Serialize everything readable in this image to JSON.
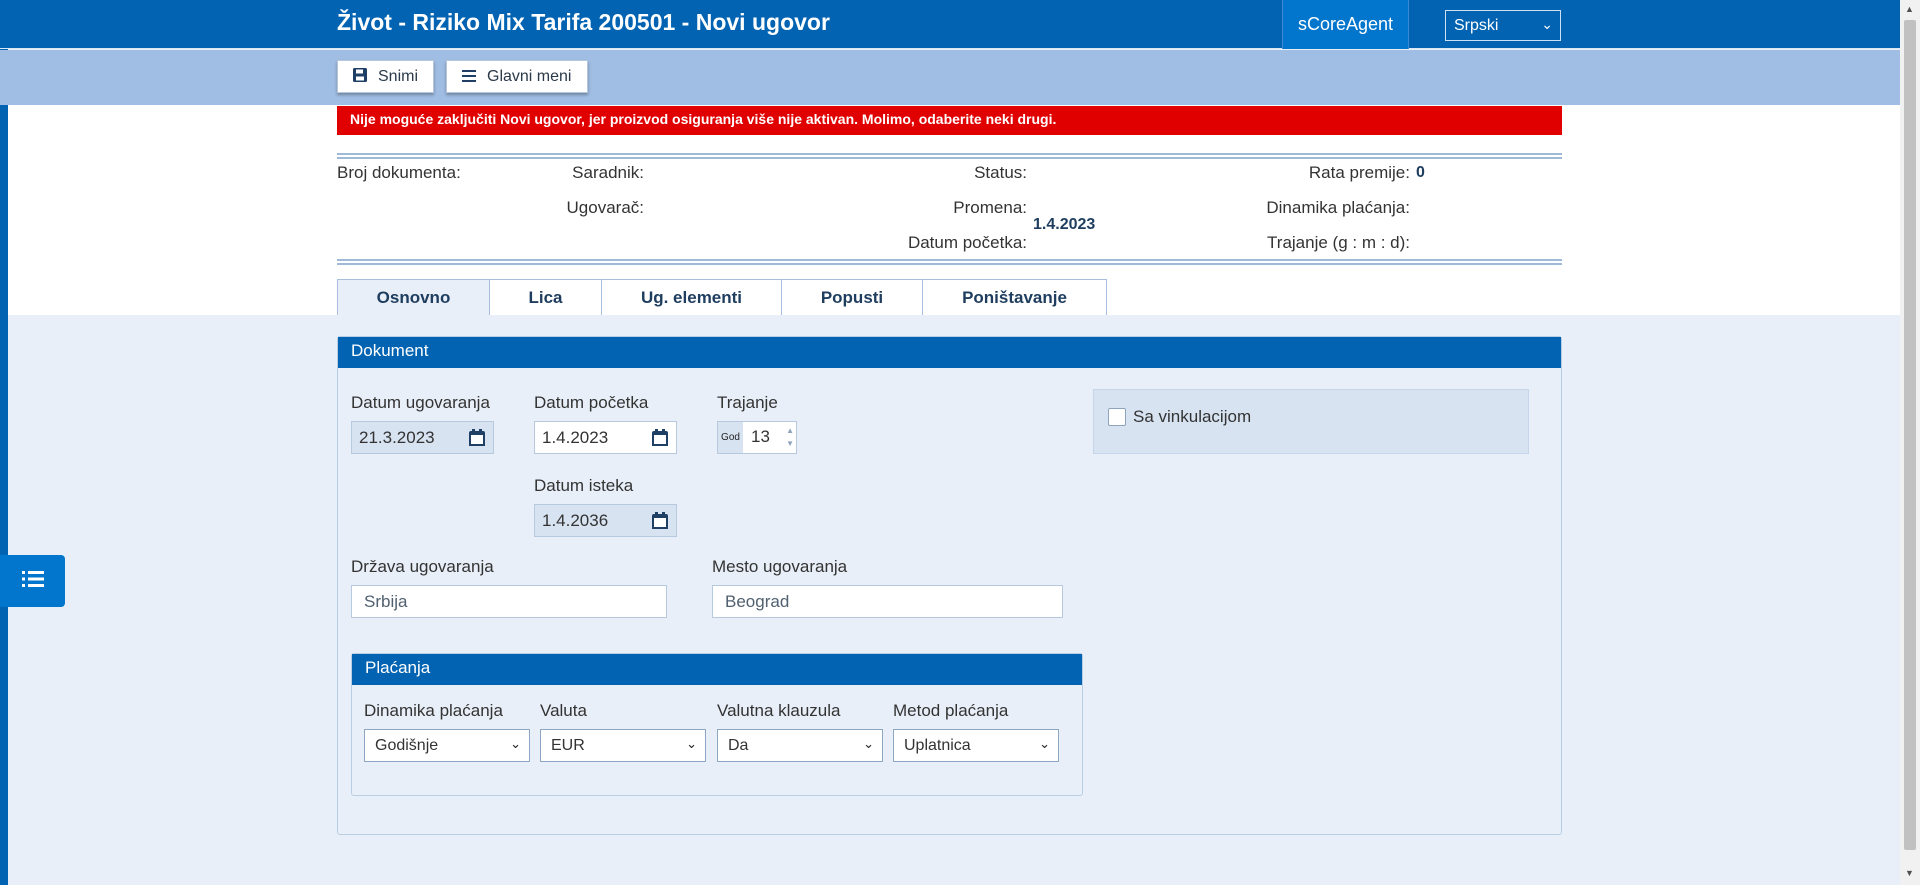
{
  "header": {
    "title": "Život - Riziko Mix Tarifa 200501 - Novi ugovor",
    "agent": "sCoreAgent",
    "language": "Srpski"
  },
  "toolbar": {
    "save_label": "Snimi",
    "menu_label": "Glavni meni"
  },
  "error_message": "Nije moguće zaključiti Novi ugovor, jer proizvod osiguranja više nije aktivan. Molimo, odaberite neki drugi.",
  "doc_info": {
    "broj_dokumenta_label": "Broj dokumenta:",
    "saradnik_label": "Saradnik:",
    "ugovarac_label": "Ugovarač:",
    "status_label": "Status:",
    "promena_label": "Promena:",
    "datum_pocetka_label": "Datum početka:",
    "datum_pocetka_value": "1.4.2023",
    "rata_premije_label": "Rata premije:",
    "rata_premije_value": "0",
    "dinamika_label": "Dinamika plaćanja:",
    "trajanje_label": "Trajanje (g : m : d):"
  },
  "tabs": [
    {
      "label": "Osnovno",
      "active": true
    },
    {
      "label": "Lica",
      "active": false
    },
    {
      "label": "Ug. elementi",
      "active": false
    },
    {
      "label": "Popusti",
      "active": false
    },
    {
      "label": "Poništavanje",
      "active": false
    }
  ],
  "dokument": {
    "title": "Dokument",
    "datum_ugovaranja_label": "Datum ugovaranja",
    "datum_ugovaranja_value": "21.3.2023",
    "datum_pocetka_label": "Datum početka",
    "datum_pocetka_value": "1.4.2023",
    "trajanje_label": "Trajanje",
    "trajanje_unit": "God",
    "trajanje_value": "13",
    "datum_isteka_label": "Datum isteka",
    "datum_isteka_value": "1.4.2036",
    "drzava_label": "Država ugovaranja",
    "drzava_value": "Srbija",
    "mesto_label": "Mesto ugovaranja",
    "mesto_value": "Beograd",
    "vinkulacija_label": "Sa vinkulacijom"
  },
  "placanja": {
    "title": "Plaćanja",
    "dinamika_label": "Dinamika plaćanja",
    "dinamika_value": "Godišnje",
    "valuta_label": "Valuta",
    "valuta_value": "EUR",
    "klauzula_label": "Valutna klauzula",
    "klauzula_value": "Da",
    "metod_label": "Metod plaćanja",
    "metod_value": "Uplatnica"
  },
  "colors": {
    "primary": "#0163b1",
    "toolbar": "#a0bde3",
    "error": "#e10000",
    "panel_bg": "#e8eff8"
  }
}
